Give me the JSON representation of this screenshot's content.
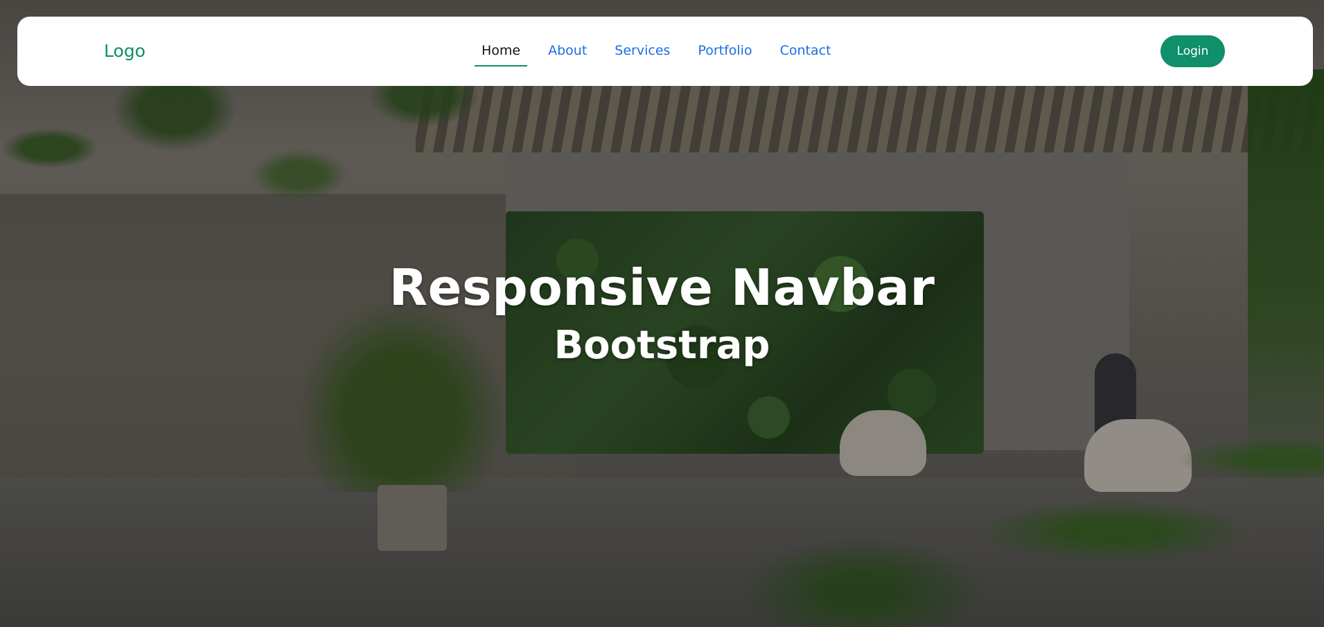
{
  "navbar": {
    "logo": "Logo",
    "links": [
      {
        "label": "Home",
        "active": true
      },
      {
        "label": "About",
        "active": false
      },
      {
        "label": "Services",
        "active": false
      },
      {
        "label": "Portfolio",
        "active": false
      },
      {
        "label": "Contact",
        "active": false
      }
    ],
    "login_label": "Login"
  },
  "hero": {
    "title": "Responsive Navbar",
    "subtitle": "Bootstrap"
  },
  "colors": {
    "accent": "#0f8f6a",
    "link": "#1a6fe0",
    "active_link": "#111111",
    "navbar_bg": "#ffffff"
  }
}
